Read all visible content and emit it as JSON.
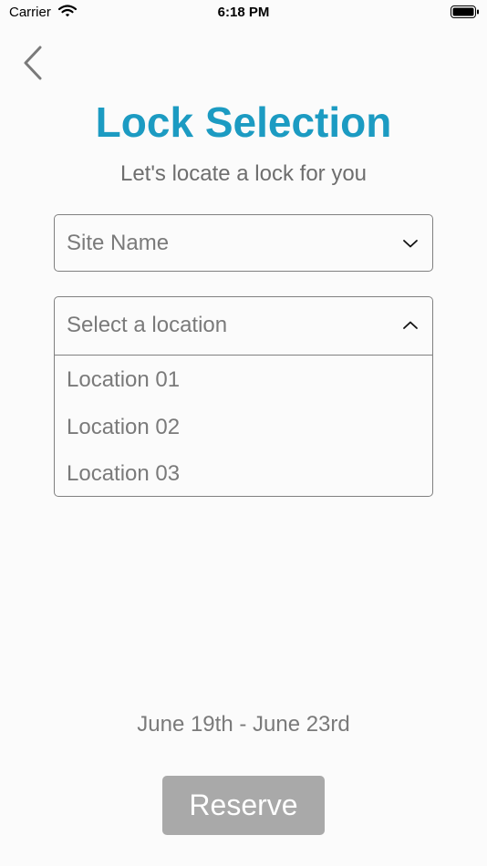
{
  "status_bar": {
    "carrier": "Carrier",
    "time": "6:18 PM",
    "wifi_icon": "wifi-icon",
    "battery_icon": "battery-icon"
  },
  "nav": {
    "back_icon": "chevron-left-icon"
  },
  "header": {
    "title": "Lock Selection",
    "subtitle": "Let's locate a lock for you"
  },
  "site_dropdown": {
    "value": "Site Name",
    "icon": "chevron-down-icon"
  },
  "location_dropdown": {
    "placeholder": "Select a location",
    "icon": "chevron-up-icon",
    "expanded": true,
    "options": [
      "Location 01",
      "Location 02",
      "Location 03"
    ]
  },
  "dates": "June 19th - June 23rd",
  "reserve_button": {
    "label": "Reserve",
    "enabled": false
  },
  "colors": {
    "accent": "#1c9bc2",
    "background": "#fbfbfb",
    "text_muted": "#7a7a7a",
    "button_disabled": "#a9a9a9",
    "border": "#808080"
  }
}
